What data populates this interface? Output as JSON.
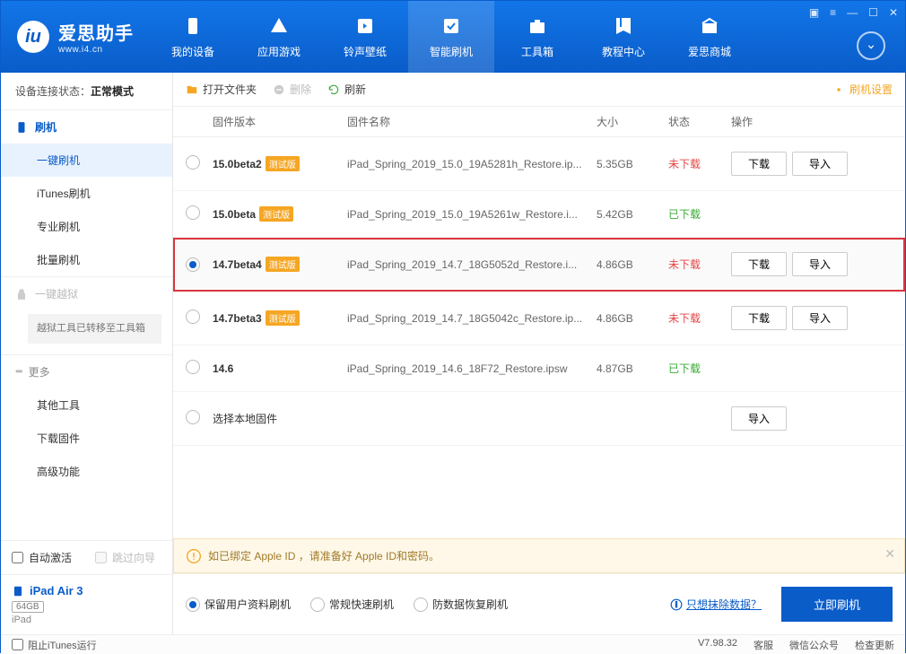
{
  "app": {
    "name_cn": "爱思助手",
    "name_en": "www.i4.cn"
  },
  "nav": [
    {
      "label": "我的设备"
    },
    {
      "label": "应用游戏"
    },
    {
      "label": "铃声壁纸"
    },
    {
      "label": "智能刷机",
      "active": true
    },
    {
      "label": "工具箱"
    },
    {
      "label": "教程中心"
    },
    {
      "label": "爱思商城"
    }
  ],
  "connection": {
    "label": "设备连接状态：",
    "value": "正常模式"
  },
  "sidebar": {
    "flash_header": "刷机",
    "flash_items": [
      "一键刷机",
      "iTunes刷机",
      "专业刷机",
      "批量刷机"
    ],
    "jailbreak_header": "一键越狱",
    "jailbreak_note": "越狱工具已转移至工具箱",
    "more_header": "更多",
    "more_items": [
      "其他工具",
      "下载固件",
      "高级功能"
    ],
    "auto_activate": "自动激活",
    "skip_guide": "跳过向导",
    "device_name": "iPad Air 3",
    "device_storage": "64GB",
    "device_type": "iPad",
    "block_itunes": "阻止iTunes运行"
  },
  "toolbar": {
    "open": "打开文件夹",
    "delete": "删除",
    "refresh": "刷新",
    "settings": "刷机设置"
  },
  "table": {
    "headers": {
      "version": "固件版本",
      "name": "固件名称",
      "size": "大小",
      "status": "状态",
      "ops": "操作"
    },
    "btn_download": "下载",
    "btn_import": "导入",
    "local_label": "选择本地固件",
    "rows": [
      {
        "version": "15.0beta2",
        "tag": "测试版",
        "name": "iPad_Spring_2019_15.0_19A5281h_Restore.ip...",
        "size": "5.35GB",
        "status": "未下载",
        "status_cls": "st-red",
        "selected": false,
        "highlight": false,
        "download": true
      },
      {
        "version": "15.0beta",
        "tag": "测试版",
        "name": "iPad_Spring_2019_15.0_19A5261w_Restore.i...",
        "size": "5.42GB",
        "status": "已下载",
        "status_cls": "st-green",
        "selected": false,
        "highlight": false,
        "download": false
      },
      {
        "version": "14.7beta4",
        "tag": "测试版",
        "name": "iPad_Spring_2019_14.7_18G5052d_Restore.i...",
        "size": "4.86GB",
        "status": "未下载",
        "status_cls": "st-red",
        "selected": true,
        "highlight": true,
        "download": true
      },
      {
        "version": "14.7beta3",
        "tag": "测试版",
        "name": "iPad_Spring_2019_14.7_18G5042c_Restore.ip...",
        "size": "4.86GB",
        "status": "未下载",
        "status_cls": "st-red",
        "selected": false,
        "highlight": false,
        "download": true
      },
      {
        "version": "14.6",
        "tag": "",
        "name": "iPad_Spring_2019_14.6_18F72_Restore.ipsw",
        "size": "4.87GB",
        "status": "已下载",
        "status_cls": "st-green",
        "selected": false,
        "highlight": false,
        "download": false
      }
    ]
  },
  "notice": "如已绑定 Apple ID ，请准备好 Apple ID和密码。",
  "flash_options": {
    "keep_data": "保留用户资料刷机",
    "normal": "常规快速刷机",
    "anti_reset": "防数据恢复刷机",
    "erase_link": "只想抹除数据？",
    "flash_btn": "立即刷机"
  },
  "statusbar": {
    "version": "V7.98.32",
    "service": "客服",
    "wechat": "微信公众号",
    "update": "检查更新"
  }
}
